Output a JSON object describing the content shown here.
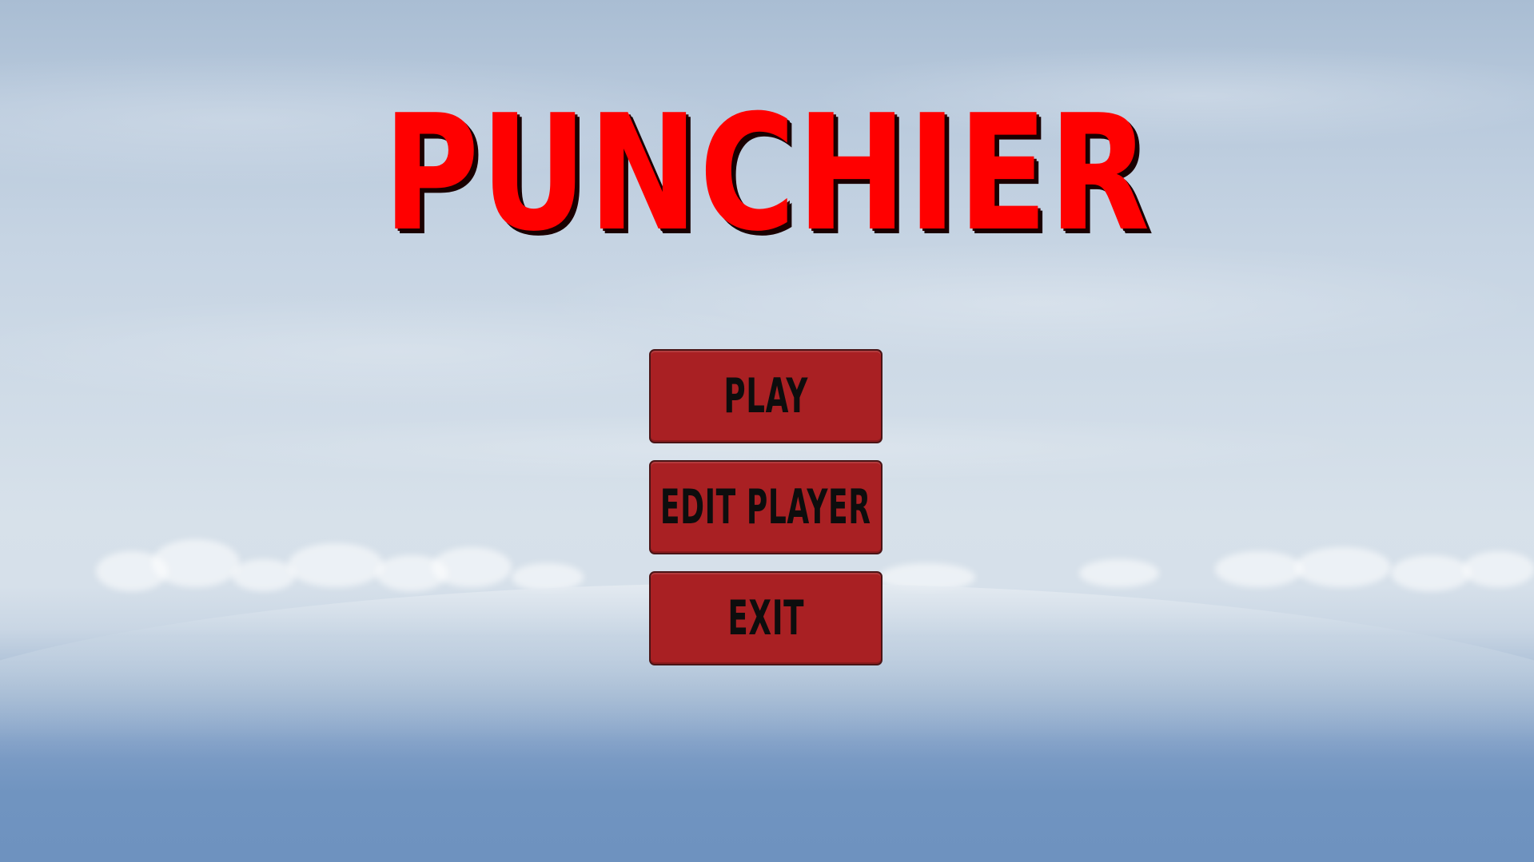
{
  "game": {
    "title": "PUNCHIER"
  },
  "menu": {
    "items": [
      {
        "id": "play",
        "label": "PLAY"
      },
      {
        "id": "edit-player",
        "label": "EDIT PLAYER"
      },
      {
        "id": "exit",
        "label": "EXIT"
      }
    ]
  },
  "colors": {
    "title": "#ff0000",
    "button_fill": "#a92023",
    "button_border": "#4a1416",
    "button_text": "#0d0d0d",
    "sky_top": "#a9bdd3",
    "sky_bottom": "#6e92bf"
  }
}
